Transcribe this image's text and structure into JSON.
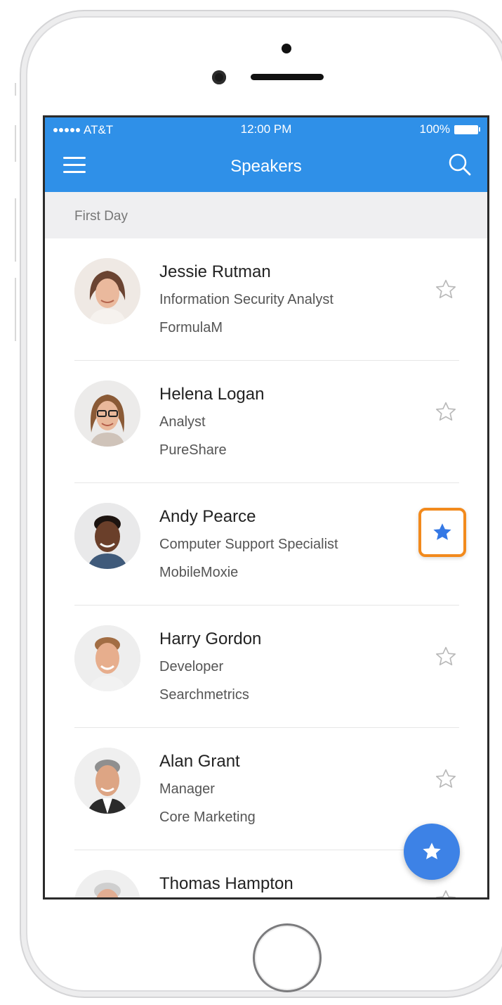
{
  "status_bar": {
    "carrier": "AT&T",
    "time": "12:00 PM",
    "battery": "100%"
  },
  "appbar": {
    "title": "Speakers",
    "menu_icon": "menu-icon",
    "search_icon": "search-icon"
  },
  "section": {
    "title": "First Day"
  },
  "colors": {
    "appbar": "#2f90e8",
    "fab": "#3d82e6",
    "highlight": "#f28a1d",
    "star_filled": "#3478e5"
  },
  "speakers": [
    {
      "name": "Jessie Rutman",
      "role": "Information Security Analyst",
      "company": "FormulaM",
      "favorite": false
    },
    {
      "name": "Helena Logan",
      "role": "Analyst",
      "company": "PureShare",
      "favorite": false
    },
    {
      "name": "Andy Pearce",
      "role": "Computer Support Specialist",
      "company": "MobileMoxie",
      "favorite": true
    },
    {
      "name": "Harry Gordon",
      "role": "Developer",
      "company": "Searchmetrics",
      "favorite": false
    },
    {
      "name": "Alan Grant",
      "role": "Manager",
      "company": "Core Marketing",
      "favorite": false
    },
    {
      "name": "Thomas Hampton",
      "role": "",
      "company": "",
      "favorite": false
    }
  ],
  "fab": {
    "icon": "star-icon"
  }
}
